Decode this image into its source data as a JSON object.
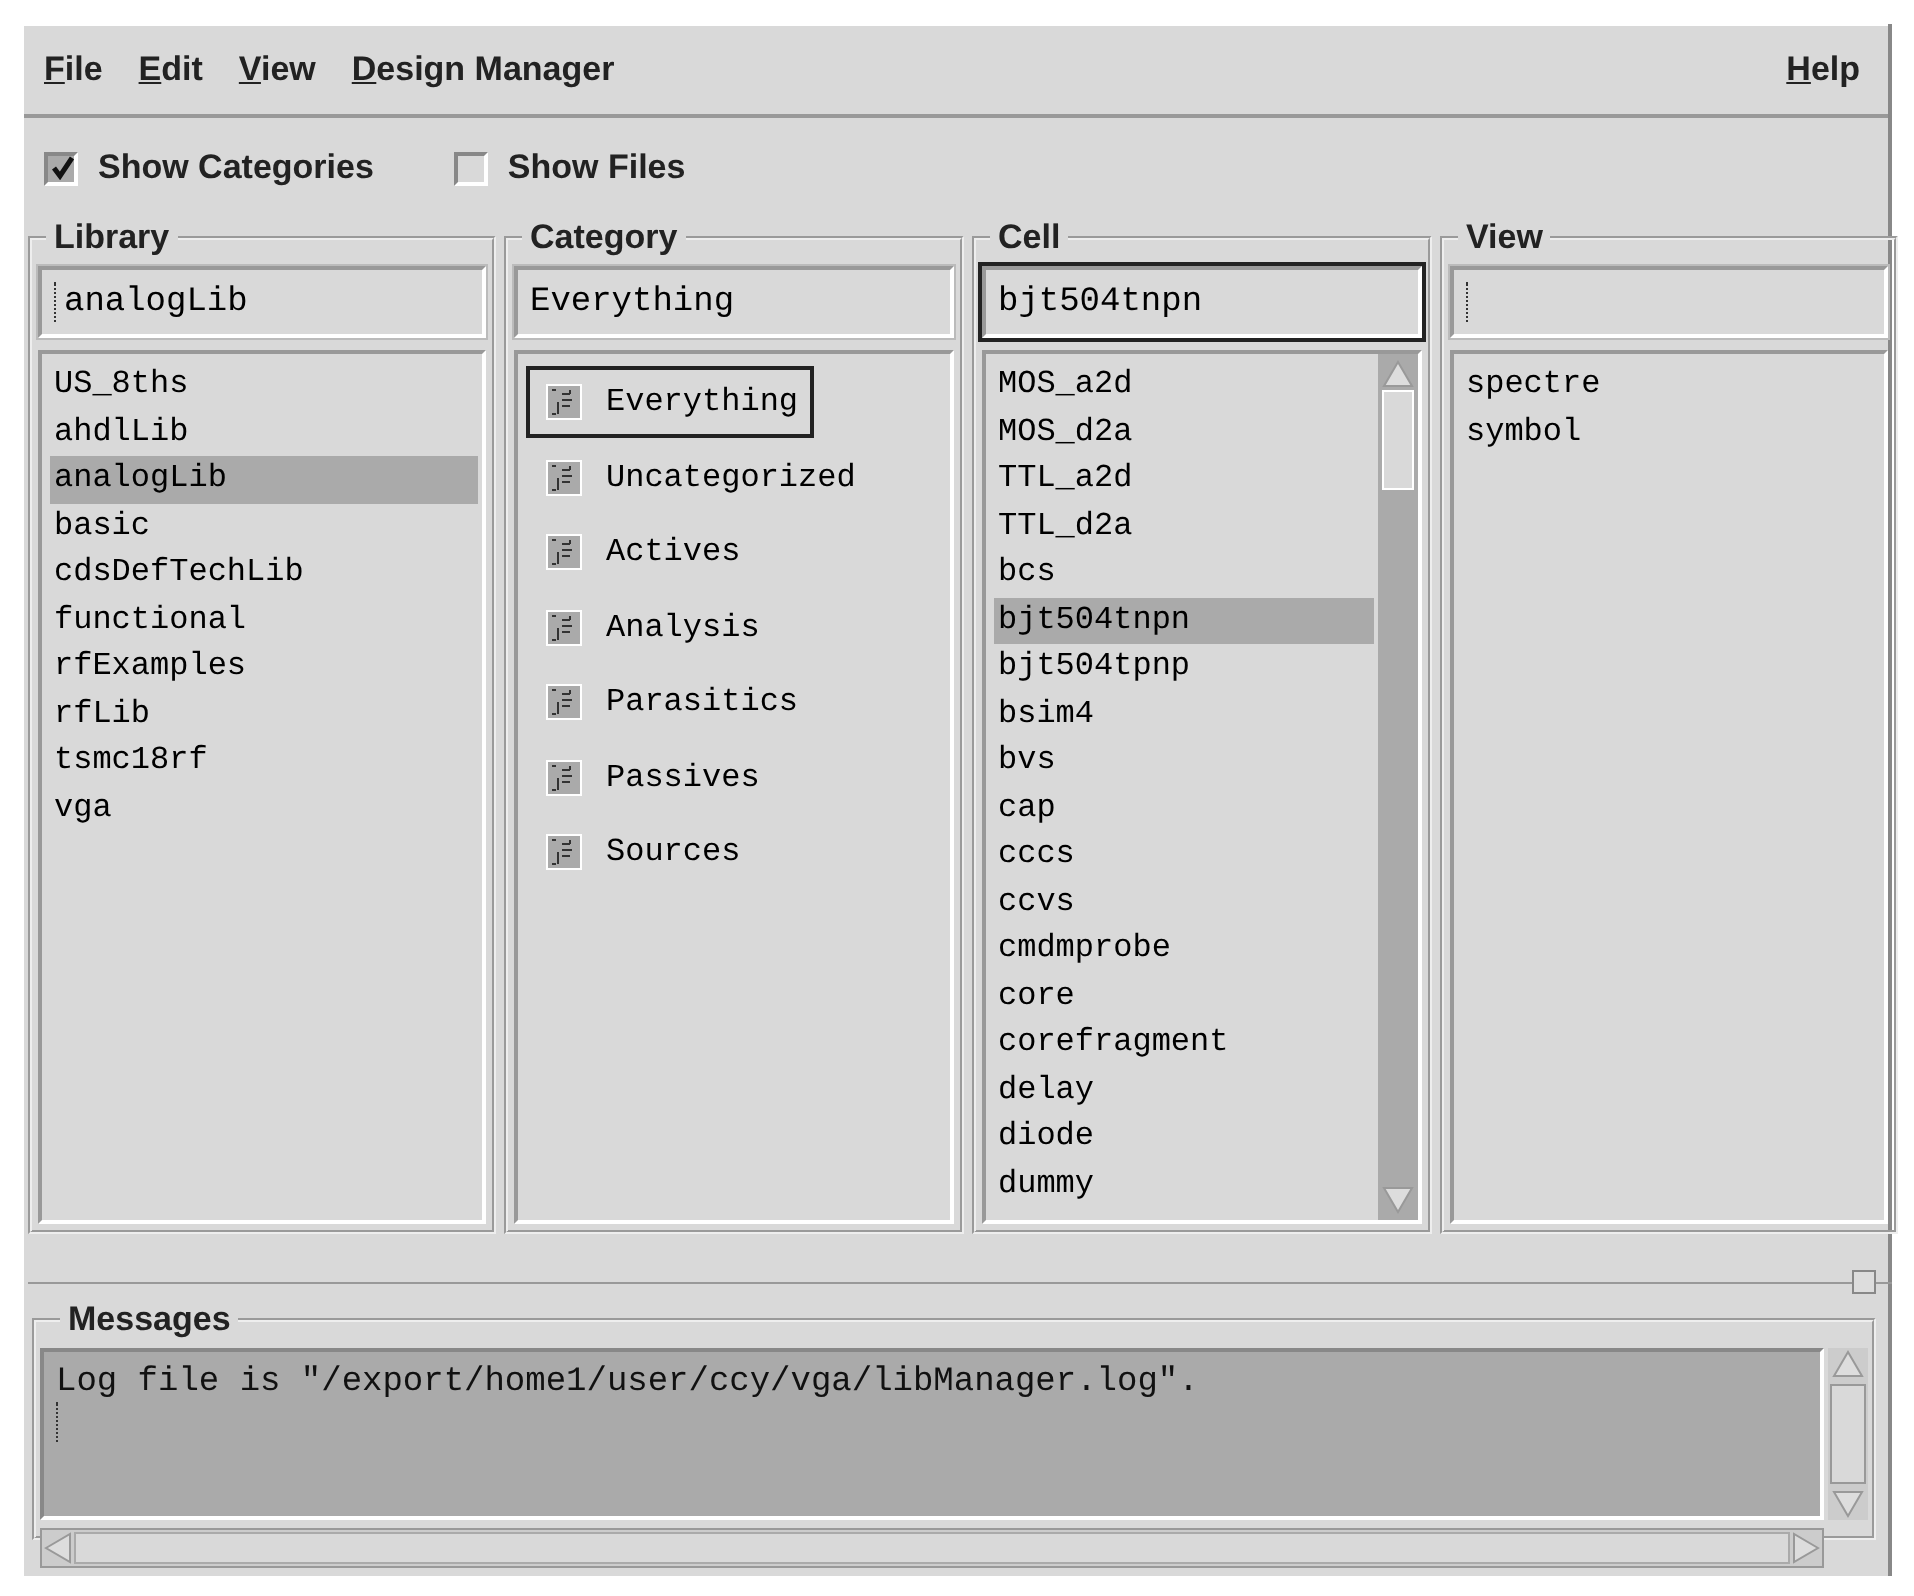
{
  "menubar": {
    "items": [
      "File",
      "Edit",
      "View",
      "Design Manager"
    ],
    "help": "Help"
  },
  "options": [
    {
      "label": "Show Categories",
      "checked": true
    },
    {
      "label": "Show Files",
      "checked": false
    }
  ],
  "panels": [
    {
      "title": "Library",
      "field": "analogLib",
      "cursor": true,
      "kind": "text",
      "items": [
        {
          "label": "US_8ths",
          "selected": false
        },
        {
          "label": "ahdlLib",
          "selected": false
        },
        {
          "label": "analogLib",
          "selected": true
        },
        {
          "label": "basic",
          "selected": false
        },
        {
          "label": "cdsDefTechLib",
          "selected": false
        },
        {
          "label": "functional",
          "selected": false
        },
        {
          "label": "rfExamples",
          "selected": false
        },
        {
          "label": "rfLib",
          "selected": false
        },
        {
          "label": "tsmc18rf",
          "selected": false
        },
        {
          "label": "vga",
          "selected": false
        }
      ]
    },
    {
      "title": "Category",
      "field": "Everything",
      "cursor": false,
      "kind": "category",
      "items": [
        {
          "label": "Everything",
          "selected": true
        },
        {
          "label": "Uncategorized",
          "selected": false
        },
        {
          "label": "Actives",
          "selected": false
        },
        {
          "label": "Analysis",
          "selected": false
        },
        {
          "label": "Parasitics",
          "selected": false
        },
        {
          "label": "Passives",
          "selected": false
        },
        {
          "label": "Sources",
          "selected": false
        }
      ]
    },
    {
      "title": "Cell",
      "field": "bjt504tnpn",
      "cursor": false,
      "focused": true,
      "kind": "scroll",
      "items": [
        {
          "label": "MOS_a2d",
          "selected": false
        },
        {
          "label": "MOS_d2a",
          "selected": false
        },
        {
          "label": "TTL_a2d",
          "selected": false
        },
        {
          "label": "TTL_d2a",
          "selected": false
        },
        {
          "label": "bcs",
          "selected": false
        },
        {
          "label": "bjt504tnpn",
          "selected": true
        },
        {
          "label": "bjt504tpnp",
          "selected": false
        },
        {
          "label": "bsim4",
          "selected": false
        },
        {
          "label": "bvs",
          "selected": false
        },
        {
          "label": "cap",
          "selected": false
        },
        {
          "label": "cccs",
          "selected": false
        },
        {
          "label": "ccvs",
          "selected": false
        },
        {
          "label": "cmdmprobe",
          "selected": false
        },
        {
          "label": "core",
          "selected": false
        },
        {
          "label": "corefragment",
          "selected": false
        },
        {
          "label": "delay",
          "selected": false
        },
        {
          "label": "diode",
          "selected": false
        },
        {
          "label": "dummy",
          "selected": false
        }
      ]
    },
    {
      "title": "View",
      "cursor": true,
      "kind": "text",
      "items": [
        {
          "label": "spectre",
          "selected": false
        },
        {
          "label": "symbol",
          "selected": false
        }
      ]
    }
  ],
  "messages": {
    "title": "Messages",
    "lines": [
      "Log file is \"/export/home1/user/ccy/vga/libManager.log\"."
    ]
  }
}
